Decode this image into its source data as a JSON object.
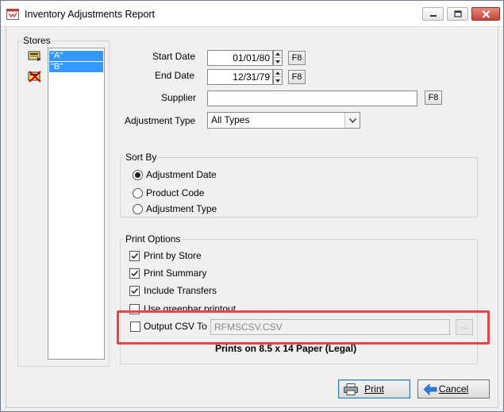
{
  "window": {
    "title": "Inventory Adjustments Report"
  },
  "stores": {
    "legend": "Stores",
    "items": [
      {
        "label": "\"A\"",
        "selected": true
      },
      {
        "label": "\"B\"",
        "selected": true
      }
    ]
  },
  "filters": {
    "start_date_label": "Start Date",
    "start_date_value": "01/01/80",
    "end_date_label": "End Date",
    "end_date_value": "12/31/79",
    "f8_label": "F8",
    "supplier_label": "Supplier",
    "supplier_value": "",
    "adjustment_type_label": "Adjustment Type",
    "adjustment_type_value": "All Types"
  },
  "sort_by": {
    "legend": "Sort By",
    "options": [
      {
        "label": "Adjustment Date",
        "selected": true
      },
      {
        "label": "Product Code",
        "selected": false
      },
      {
        "label": "Adjustment Type",
        "selected": false
      }
    ]
  },
  "print_options": {
    "legend": "Print Options",
    "checks": [
      {
        "label": "Print by Store",
        "checked": true
      },
      {
        "label": "Print Summary",
        "checked": true
      },
      {
        "label": "Include Transfers",
        "checked": true
      },
      {
        "label": "Use greenbar printout",
        "checked": false
      }
    ],
    "output_csv_label": "Output CSV To",
    "output_csv_checked": false,
    "output_csv_value": "RFMSCSV.CSV",
    "browse_label": "...",
    "paper_note": "Prints on 8.5 x 14 Paper (Legal)"
  },
  "buttons": {
    "print_label": "Print",
    "cancel_label": "Cancel"
  },
  "colors": {
    "selection": "#3399ff",
    "highlight_box": "#e0454a",
    "window_bg": "#f0f0f0"
  }
}
